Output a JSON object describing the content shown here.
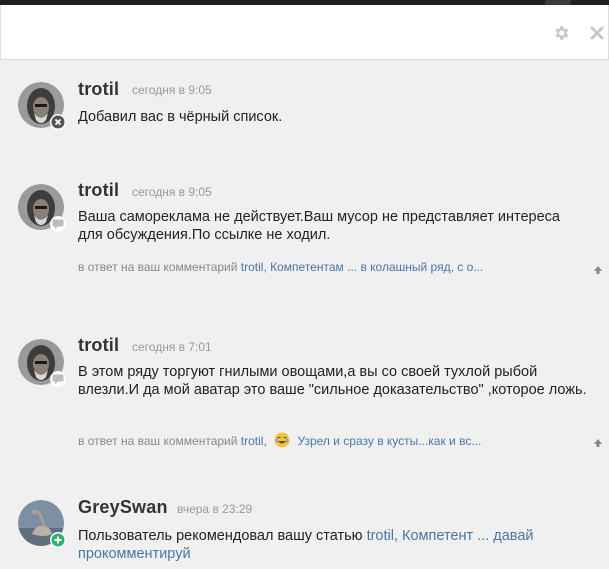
{
  "header": {
    "settings_icon": "gear-icon",
    "close_icon": "close-icon"
  },
  "notifications": [
    {
      "user": "trotil",
      "time": "сегодня в 9:05",
      "text": "Добавил вас в чёрный список.",
      "badge_icon": "close-circle-icon"
    },
    {
      "user": "trotil",
      "time": "сегодня в 9:05",
      "text": "Ваша самореклама не действует.Ваш мусор не представляет интереса для обсуждения.По ссылке не ходил.",
      "reply_prefix": "в ответ на ваш комментарий",
      "reply_link_1": "trotil, Компетентам ...",
      "reply_link_2": "в колашный ряд, с о...",
      "badge_icon": "comment-icon"
    },
    {
      "user": "trotil",
      "time": "сегодня в 7:01",
      "text": "В этом ряду торгуют гнилыми овощами,а вы со своей тухлой рыбой влезли.И да мой аватар это ваше \"сильное доказательство\" ,которое ложь.",
      "reply_prefix": "в ответ на ваш комментарий",
      "reply_link_1": "trotil,",
      "reply_link_2": "Узрел и сразу в кусты...как и вс...",
      "badge_icon": "comment-icon"
    },
    {
      "user": "GreySwan",
      "time": "вчера в 23:29",
      "text_prefix": "Пользователь рекомендовал вашу статью",
      "article_link": "trotil, Компетент ... давай прокомментируй",
      "badge_icon": "plus-icon"
    }
  ],
  "colors": {
    "link": "#4a76a8",
    "plus_badge": "#2db36f",
    "background": "#f0f0f0"
  }
}
